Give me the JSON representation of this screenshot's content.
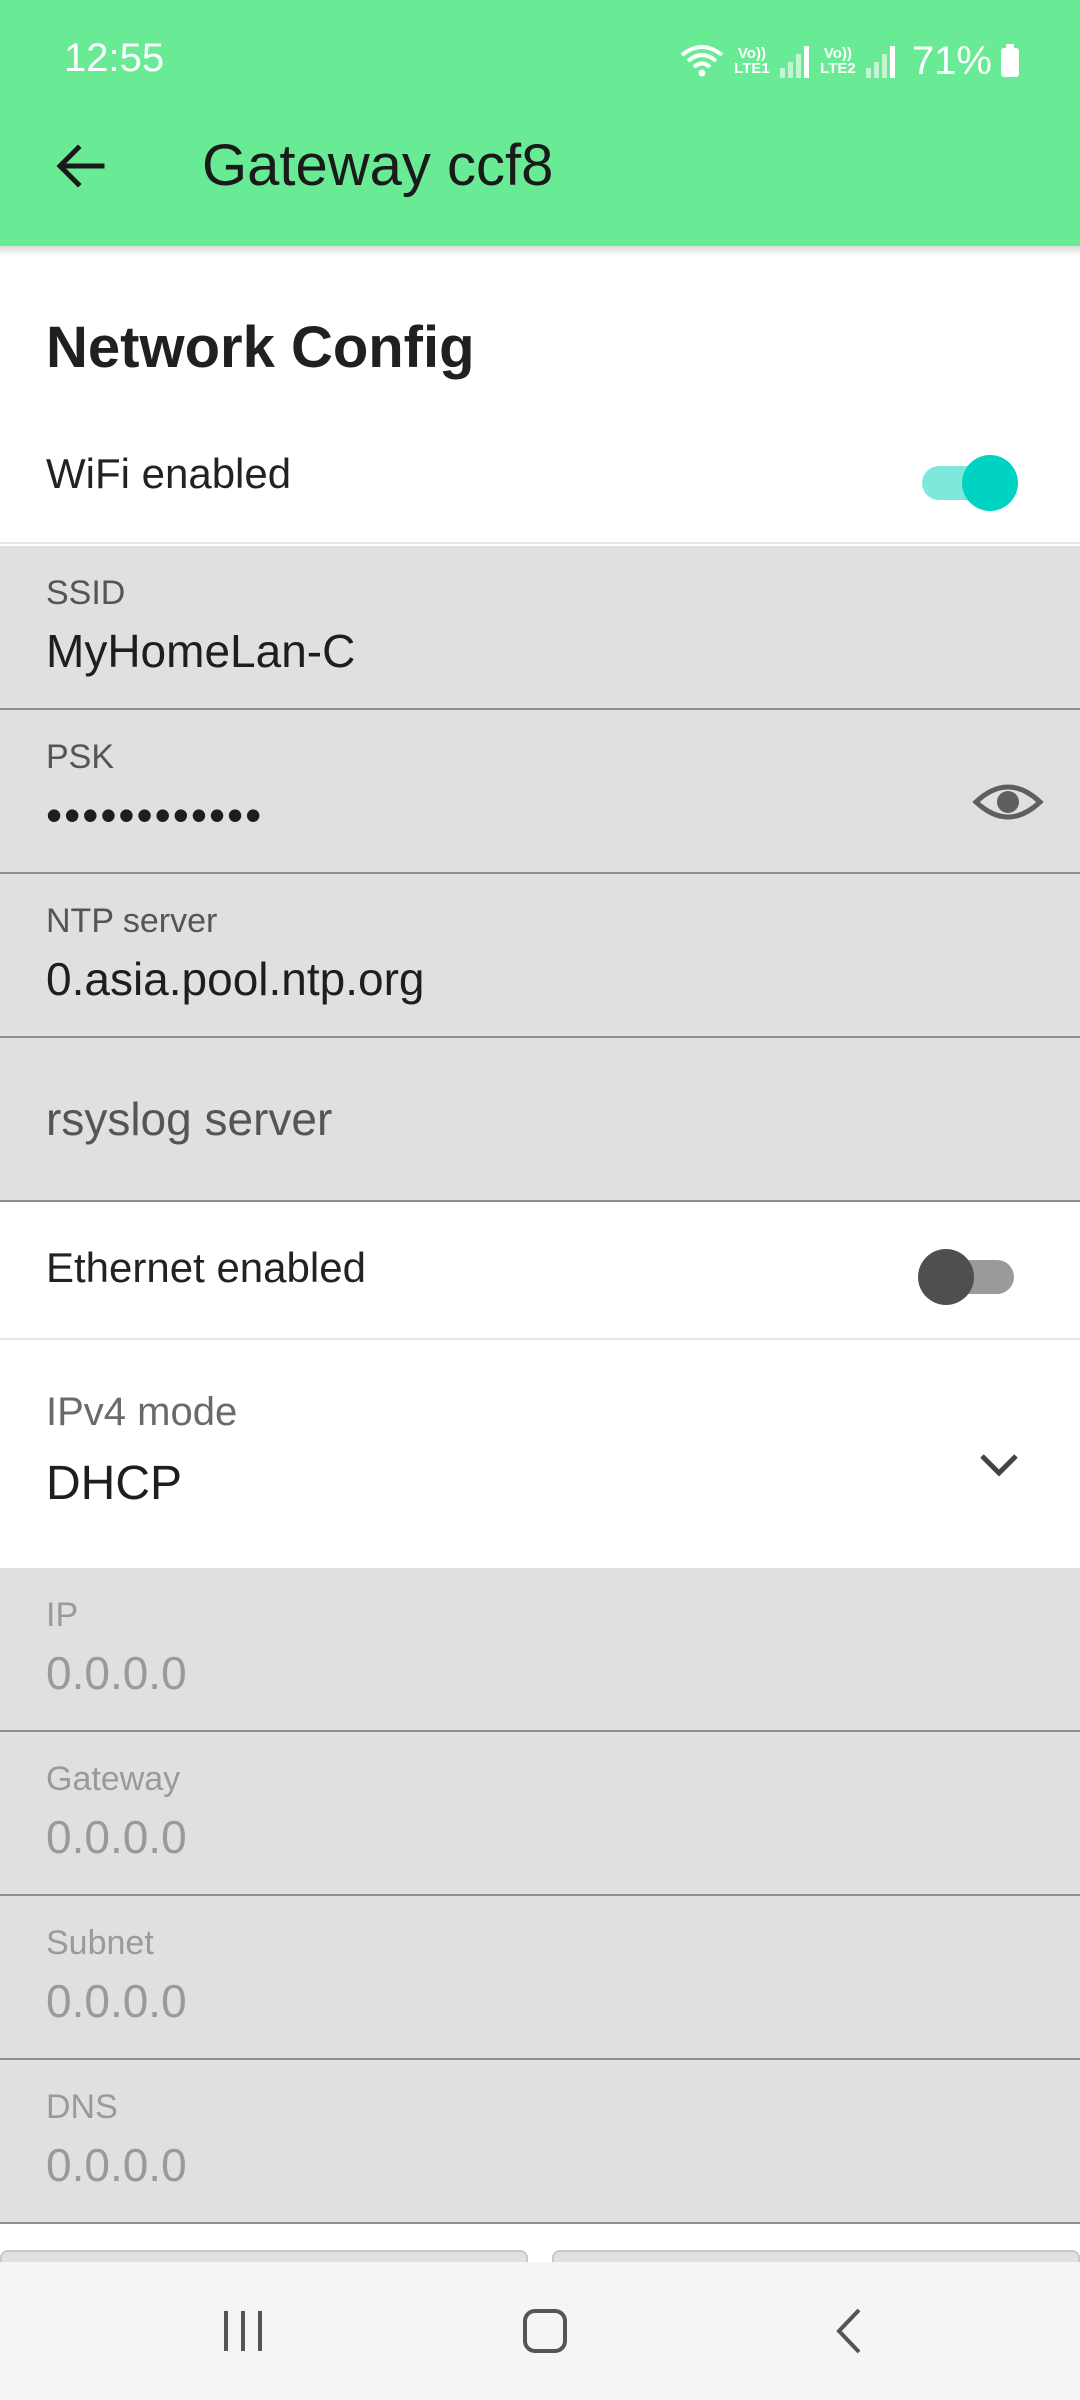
{
  "status_bar": {
    "time": "12:55",
    "sim1_badge": "Vo)) LTE1",
    "sim2_badge": "Vo)) LTE2",
    "battery_percent": "71%",
    "icons": [
      "wifi-icon",
      "signal-icon",
      "signal-icon",
      "battery-icon"
    ]
  },
  "app_bar": {
    "title": "Gateway ccf8",
    "back_icon": "arrow-back-icon",
    "color": "#69ea95"
  },
  "section": {
    "title": "Network Config"
  },
  "wifi": {
    "label": "WiFi enabled",
    "enabled": true,
    "ssid": {
      "label": "SSID",
      "value": "MyHomeLan-C"
    },
    "psk": {
      "label": "PSK",
      "value": "••••••••••••",
      "toggle_icon": "eye-icon"
    },
    "ntp": {
      "label": "NTP server",
      "value": "0.asia.pool.ntp.org"
    },
    "rsyslog": {
      "placeholder": "rsyslog server"
    }
  },
  "ethernet": {
    "label": "Ethernet enabled",
    "enabled": false,
    "ipv4_mode": {
      "label": "IPv4 mode",
      "value": "DHCP",
      "icon": "chevron-down-icon"
    },
    "ip": {
      "label": "IP",
      "value": "0.0.0.0"
    },
    "gateway": {
      "label": "Gateway",
      "value": "0.0.0.0"
    },
    "subnet": {
      "label": "Subnet",
      "value": "0.0.0.0"
    },
    "dns": {
      "label": "DNS",
      "value": "0.0.0.0"
    }
  },
  "nav_bar": {
    "buttons": [
      "recents-icon",
      "home-icon",
      "back-icon"
    ]
  },
  "colors": {
    "accent": "#00d3c1",
    "field_bg": "#e0e0e0"
  }
}
